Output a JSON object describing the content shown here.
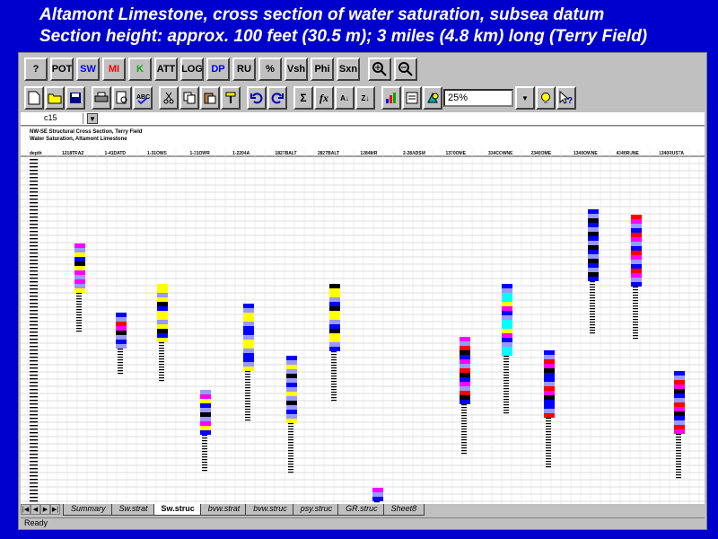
{
  "slide": {
    "title_line1": "Altamont Limestone, cross section of water saturation, subsea datum",
    "title_line2": "Section height: approx. 100 feet (30.5 m); 3 miles (4.8 km) long (Terry Field)"
  },
  "toolbar1": {
    "buttons": [
      "?",
      "POT",
      "SW",
      "MI",
      "K",
      "ATT",
      "LOG",
      "DP",
      "RU",
      "%",
      "Vsh",
      "Phi",
      "Sxn"
    ]
  },
  "toolbar2": {
    "zoom_value": "25%"
  },
  "formula_bar": {
    "name_box": "c15"
  },
  "sheet": {
    "title1": "NW-SE Structural Cross Section, Terry Field",
    "title2": "Water Saturation, Altamont Limestone",
    "header_first": "depth",
    "well_headers": [
      "1218TRAZ",
      "1-41DATD",
      "1-31OWS",
      "1-31OWR",
      "1-2204A",
      "1827BALT",
      "2827BALT",
      "1284MR",
      "2-28ADSM",
      "1370OME",
      "334COWNE",
      "2340OME",
      "1340OWNE",
      "4340RUNE",
      "1340RUSTA"
    ]
  },
  "sheet_tabs": [
    "Summary",
    "Sw.strat",
    "Sw.struc",
    "bvw.strat",
    "bvw.struc",
    "psy.struc",
    "GR.struc",
    "Sheet8"
  ],
  "active_tab": "Sw.struc",
  "status": {
    "text": "Ready"
  },
  "colors": {
    "background": "#0000cc",
    "window": "#c0c0c0",
    "sw_magenta": "#ff00ff",
    "sw_blue": "#0000ff",
    "sw_red": "#ff0000",
    "sw_yellow": "#ffff00",
    "sw_cyan": "#00ffff",
    "sw_lavender": "#9999ff",
    "sw_black": "#000000"
  }
}
